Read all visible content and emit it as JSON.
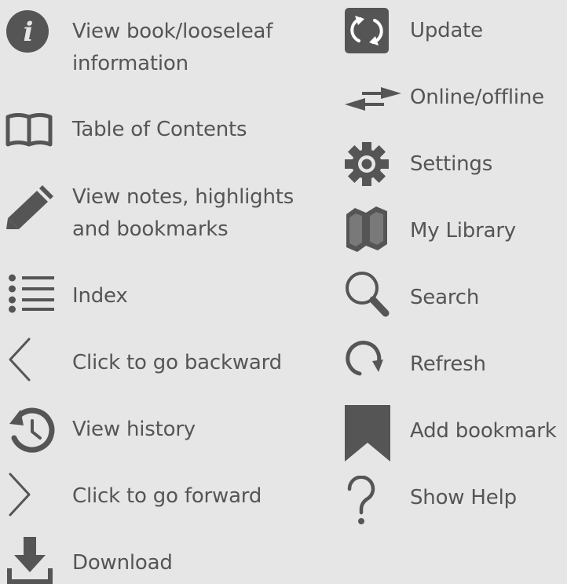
{
  "colors": {
    "background": "#e6e6e6",
    "icon": "#555555",
    "text": "#555555"
  },
  "left_column": [
    {
      "icon": "info-icon",
      "label_line1": "View book/looseleaf",
      "label_line2": "information"
    },
    {
      "icon": "book-icon",
      "label": "Table of Contents"
    },
    {
      "icon": "pencil-icon",
      "label_line1": "View notes, highlights",
      "label_line2": "and bookmarks"
    },
    {
      "icon": "list-icon",
      "label": "Index"
    },
    {
      "icon": "chevron-left-icon",
      "label": "Click to go backward"
    },
    {
      "icon": "history-icon",
      "label": "View history"
    },
    {
      "icon": "chevron-right-icon",
      "label": "Click to go forward"
    },
    {
      "icon": "download-icon",
      "label": "Download"
    }
  ],
  "right_column": [
    {
      "icon": "update-icon",
      "label": "Update"
    },
    {
      "icon": "online-offline-icon",
      "label": "Online/offline"
    },
    {
      "icon": "gear-icon",
      "label": "Settings"
    },
    {
      "icon": "library-icon",
      "label": "My Library"
    },
    {
      "icon": "search-icon",
      "label": "Search"
    },
    {
      "icon": "refresh-icon",
      "label": "Refresh"
    },
    {
      "icon": "bookmark-icon",
      "label": "Add bookmark"
    },
    {
      "icon": "help-icon",
      "label": "Show Help"
    }
  ]
}
